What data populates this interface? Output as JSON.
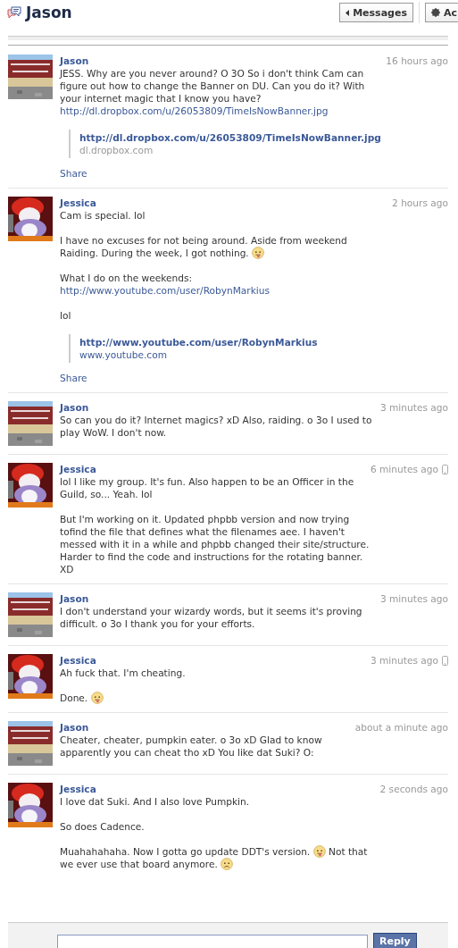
{
  "header": {
    "title": "Jason",
    "buttons": [
      {
        "label": "Messages",
        "kind": "back"
      },
      {
        "label": "Ac",
        "kind": "actions"
      }
    ]
  },
  "messages": [
    {
      "sender": "Jason",
      "time": "16 hours ago",
      "mobile": false,
      "avatar": {
        "kind": "picture"
      },
      "paragraphs": [
        [
          {
            "kind": "text",
            "text": "JESS. Why are you never around? O 3O So i don't think Cam can figure out how to change the Banner on DU. Can you do it? With your internet magic that I know you have? "
          },
          {
            "kind": "link",
            "text": "http://dl.dropbox.com/u/26053809/TimeIsNowBanner.jpg"
          }
        ]
      ],
      "attachment": {
        "title": "http://dl.dropbox.com/u/26053809/TimeIsNowBanner.jpg",
        "domain": "dl.dropbox.com",
        "domain_link": false
      },
      "share": "Share"
    },
    {
      "sender": "Jessica",
      "time": "2 hours ago",
      "mobile": false,
      "avatar": {
        "kind": "picture"
      },
      "paragraphs": [
        [
          {
            "kind": "text",
            "text": "Cam is special. lol"
          }
        ],
        [
          {
            "kind": "text",
            "text": "I have no excuses for not being around. Aside from weekend Raiding. During the week, I got nothing. "
          },
          {
            "kind": "tongue"
          }
        ],
        [
          {
            "kind": "text",
            "text": "What I do on the weekends: "
          },
          {
            "kind": "link",
            "text": "http://www.youtube.com/user/RobynMarkius"
          }
        ],
        [
          {
            "kind": "text",
            "text": "lol"
          }
        ]
      ],
      "attachment": {
        "title": "http://www.youtube.com/user/RobynMarkius",
        "domain": "www.youtube.com",
        "domain_link": true
      },
      "share": "Share"
    },
    {
      "sender": "Jason",
      "time": "3 minutes ago",
      "mobile": false,
      "avatar": {
        "kind": "picture"
      },
      "paragraphs": [
        [
          {
            "kind": "text",
            "text": "So can you do it? Internet magics? xD Also, raiding. o 3o I used to play WoW. I don't now."
          }
        ]
      ]
    },
    {
      "sender": "Jessica",
      "time": "6 minutes ago",
      "mobile": true,
      "avatar": {
        "kind": "picture"
      },
      "paragraphs": [
        [
          {
            "kind": "text",
            "text": "lol I like my group. It's fun. Also happen to be an Officer in the Guild, so... Yeah. lol"
          }
        ],
        [
          {
            "kind": "text",
            "text": "But I'm working on it. Updated phpbb version and now trying tofind the file that defines what the filenames aee. I haven't messed with it in a while and phpbb changed their site/structure. Harder to find the code and instructions for the rotating banner. XD"
          }
        ]
      ]
    },
    {
      "sender": "Jason",
      "time": "3 minutes ago",
      "mobile": false,
      "avatar": {
        "kind": "picture"
      },
      "paragraphs": [
        [
          {
            "kind": "text",
            "text": "I don't understand your wizardy words, but it seems it's proving difficult. o 3o I thank you for your efforts."
          }
        ]
      ]
    },
    {
      "sender": "Jessica",
      "time": "3 minutes ago",
      "mobile": true,
      "avatar": {
        "kind": "picture"
      },
      "paragraphs": [
        [
          {
            "kind": "text",
            "text": "Ah fuck that. I'm cheating."
          }
        ],
        [
          {
            "kind": "text",
            "text": "Done. "
          },
          {
            "kind": "tongue"
          }
        ]
      ]
    },
    {
      "sender": "Jason",
      "time": "about a minute ago",
      "mobile": false,
      "avatar": {
        "kind": "picture"
      },
      "paragraphs": [
        [
          {
            "kind": "text",
            "text": "Cheater, cheater, pumpkin eater. o 3o xD Glad to know apparently you can cheat tho xD You like dat Suki? O:"
          }
        ]
      ]
    },
    {
      "sender": "Jessica",
      "time": "2 seconds ago",
      "mobile": false,
      "avatar": {
        "kind": "picture"
      },
      "paragraphs": [
        [
          {
            "kind": "text",
            "text": "I love dat Suki. And I also love Pumpkin."
          }
        ],
        [
          {
            "kind": "text",
            "text": "So does Cadence."
          }
        ],
        [
          {
            "kind": "text",
            "text": "Muahahahaha. Now I gotta go update DDT's version. "
          },
          {
            "kind": "tongue"
          },
          {
            "kind": "text",
            "text": " Not that we ever use that board anymore. "
          },
          {
            "kind": "frown"
          }
        ]
      ]
    }
  ],
  "reply": {
    "button": "Reply"
  }
}
